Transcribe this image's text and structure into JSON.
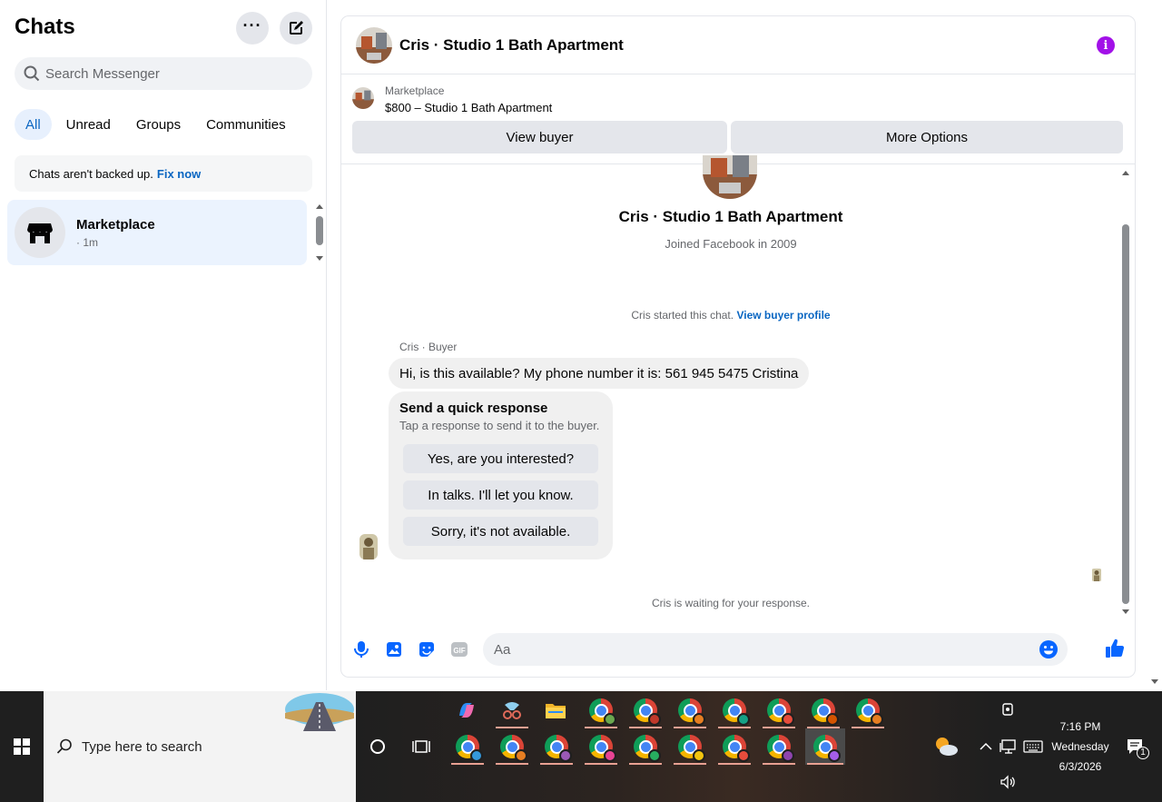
{
  "sidebar": {
    "title": "Chats",
    "search_placeholder": "Search Messenger",
    "filters": [
      "All",
      "Unread",
      "Groups",
      "Communities"
    ],
    "backup_text": "Chats aren't backed up.",
    "backup_link": "Fix now",
    "chat": {
      "name": "Marketplace",
      "time": "· 1m"
    }
  },
  "header": {
    "title": "Cris · Studio 1 Bath Apartment"
  },
  "listing": {
    "label": "Marketplace",
    "price_title": "$800 – Studio 1 Bath Apartment",
    "view_buyer": "View buyer",
    "more_options": "More Options"
  },
  "profile": {
    "name": "Cris · Studio 1 Bath Apartment",
    "joined": "Joined Facebook in 2009"
  },
  "thread": {
    "started_text": "Cris started this chat.",
    "started_link": "View buyer profile",
    "sender": "Cris · Buyer",
    "message": "Hi, is this available? My phone number it is: 561 945 5475  Cristina",
    "quick_title": "Send a quick response",
    "quick_sub": "Tap a response to send it to the buyer.",
    "quick_options": [
      "Yes, are you interested?",
      "In talks. I'll let you know.",
      "Sorry, it's not available."
    ],
    "waiting": "Cris is waiting for your response."
  },
  "composer": {
    "placeholder": "Aa"
  },
  "taskbar": {
    "search_placeholder": "Type here to search",
    "time": "7:16 PM",
    "day": "Wednesday",
    "date": "6/3/2026",
    "notification_count": "1"
  },
  "colors": {
    "accent": "#0a66c2",
    "messenger_blue": "#0866ff",
    "info_purple": "#a211e8"
  }
}
